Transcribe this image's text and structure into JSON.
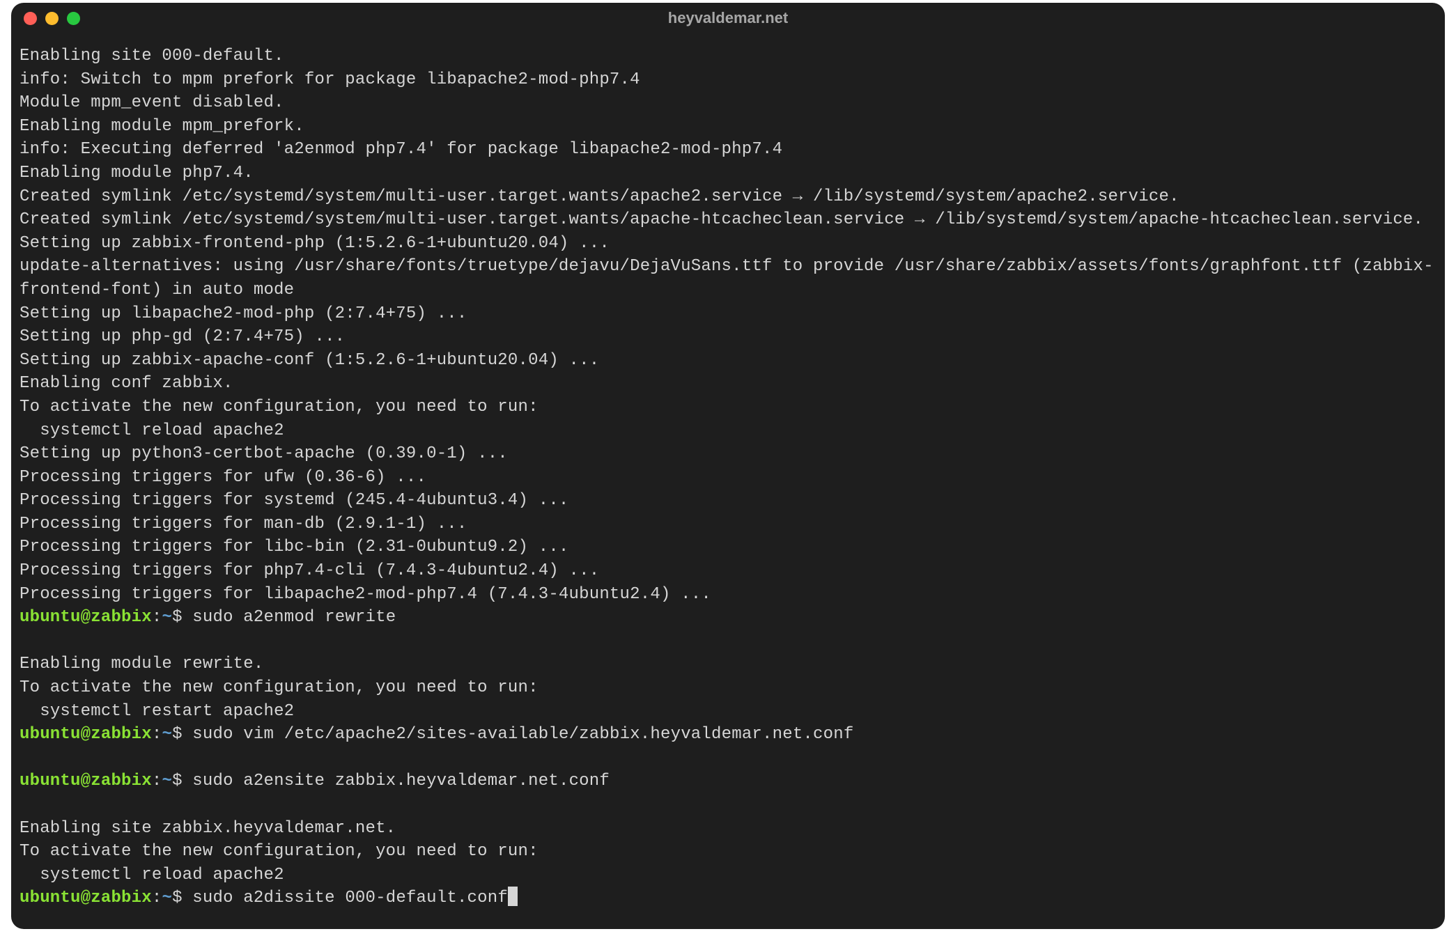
{
  "window": {
    "title": "heyvaldemar.net"
  },
  "prompt": {
    "user": "ubuntu",
    "at": "@",
    "host": "zabbix",
    "colon": ":",
    "path": "~",
    "dollar": "$"
  },
  "lines": [
    {
      "type": "out",
      "text": "Enabling site 000-default."
    },
    {
      "type": "out",
      "text": "info: Switch to mpm prefork for package libapache2-mod-php7.4"
    },
    {
      "type": "out",
      "text": "Module mpm_event disabled."
    },
    {
      "type": "out",
      "text": "Enabling module mpm_prefork."
    },
    {
      "type": "out",
      "text": "info: Executing deferred 'a2enmod php7.4' for package libapache2-mod-php7.4"
    },
    {
      "type": "out",
      "text": "Enabling module php7.4."
    },
    {
      "type": "out",
      "text": "Created symlink /etc/systemd/system/multi-user.target.wants/apache2.service → /lib/systemd/system/apache2.service."
    },
    {
      "type": "out",
      "text": "Created symlink /etc/systemd/system/multi-user.target.wants/apache-htcacheclean.service → /lib/systemd/system/apache-htcacheclean.service."
    },
    {
      "type": "out",
      "text": "Setting up zabbix-frontend-php (1:5.2.6-1+ubuntu20.04) ..."
    },
    {
      "type": "out",
      "text": "update-alternatives: using /usr/share/fonts/truetype/dejavu/DejaVuSans.ttf to provide /usr/share/zabbix/assets/fonts/graphfont.ttf (zabbix-frontend-font) in auto mode"
    },
    {
      "type": "out",
      "text": "Setting up libapache2-mod-php (2:7.4+75) ..."
    },
    {
      "type": "out",
      "text": "Setting up php-gd (2:7.4+75) ..."
    },
    {
      "type": "out",
      "text": "Setting up zabbix-apache-conf (1:5.2.6-1+ubuntu20.04) ..."
    },
    {
      "type": "out",
      "text": "Enabling conf zabbix."
    },
    {
      "type": "out",
      "text": "To activate the new configuration, you need to run:"
    },
    {
      "type": "out",
      "text": "  systemctl reload apache2"
    },
    {
      "type": "out",
      "text": "Setting up python3-certbot-apache (0.39.0-1) ..."
    },
    {
      "type": "out",
      "text": "Processing triggers for ufw (0.36-6) ..."
    },
    {
      "type": "out",
      "text": "Processing triggers for systemd (245.4-4ubuntu3.4) ..."
    },
    {
      "type": "out",
      "text": "Processing triggers for man-db (2.9.1-1) ..."
    },
    {
      "type": "out",
      "text": "Processing triggers for libc-bin (2.31-0ubuntu9.2) ..."
    },
    {
      "type": "out",
      "text": "Processing triggers for php7.4-cli (7.4.3-4ubuntu2.4) ..."
    },
    {
      "type": "out",
      "text": "Processing triggers for libapache2-mod-php7.4 (7.4.3-4ubuntu2.4) ..."
    },
    {
      "type": "prompt",
      "cmd": "sudo a2enmod rewrite"
    },
    {
      "type": "out",
      "text": "Enabling module rewrite."
    },
    {
      "type": "out",
      "text": "To activate the new configuration, you need to run:"
    },
    {
      "type": "out",
      "text": "  systemctl restart apache2"
    },
    {
      "type": "prompt",
      "cmd": "sudo vim /etc/apache2/sites-available/zabbix.heyvaldemar.net.conf"
    },
    {
      "type": "prompt",
      "cmd": "sudo a2ensite zabbix.heyvaldemar.net.conf"
    },
    {
      "type": "out",
      "text": "Enabling site zabbix.heyvaldemar.net."
    },
    {
      "type": "out",
      "text": "To activate the new configuration, you need to run:"
    },
    {
      "type": "out",
      "text": "  systemctl reload apache2"
    },
    {
      "type": "prompt",
      "cmd": "sudo a2dissite 000-default.conf",
      "cursor": true
    }
  ]
}
